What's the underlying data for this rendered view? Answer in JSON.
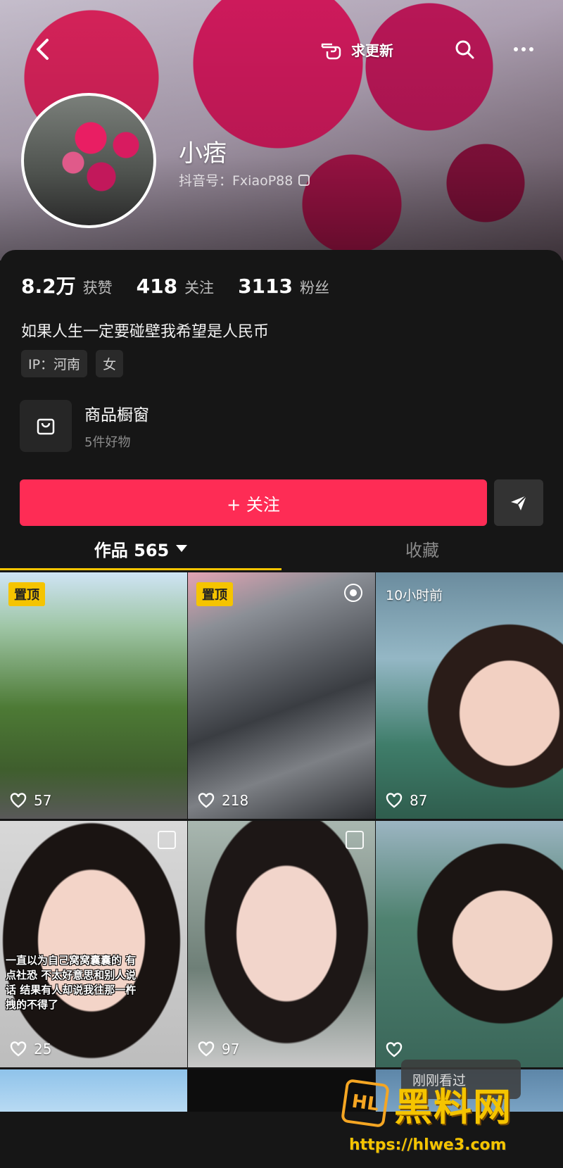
{
  "header": {
    "update_label": "求更新",
    "nickname": "小痞",
    "douyin_id": "抖音号：FxiaoP88"
  },
  "stats": [
    {
      "value": "8.2万",
      "label": "获赞"
    },
    {
      "value": "418",
      "label": "关注"
    },
    {
      "value": "3113",
      "label": "粉丝"
    }
  ],
  "bio": "如果人生一定要碰壁我希望是人民币",
  "tags": [
    "IP：河南",
    "女"
  ],
  "shop": {
    "title": "商品橱窗",
    "subtitle": "5件好物"
  },
  "follow_label": "+ 关注",
  "tabs": {
    "works": "作品 565",
    "favorites": "收藏"
  },
  "videos": [
    {
      "badge": "置顶",
      "likes": "57"
    },
    {
      "badge": "置顶",
      "likes": "218"
    },
    {
      "time": "10小时前",
      "likes": "87"
    },
    {
      "likes": "25",
      "caption": "一直以为自己窝窝囊囊的 有点社恐 不太好意思和别人说话 结果有人却说我往那一杵拽的不得了"
    },
    {
      "likes": "97"
    },
    {
      "likes": ""
    }
  ],
  "toast": "刚刚看过",
  "watermark": {
    "text": "黑料网",
    "url": "https://hlwe3.com"
  },
  "colors": {
    "follow": "#fe2c55",
    "badge": "#f5c400",
    "background": "#161616"
  }
}
